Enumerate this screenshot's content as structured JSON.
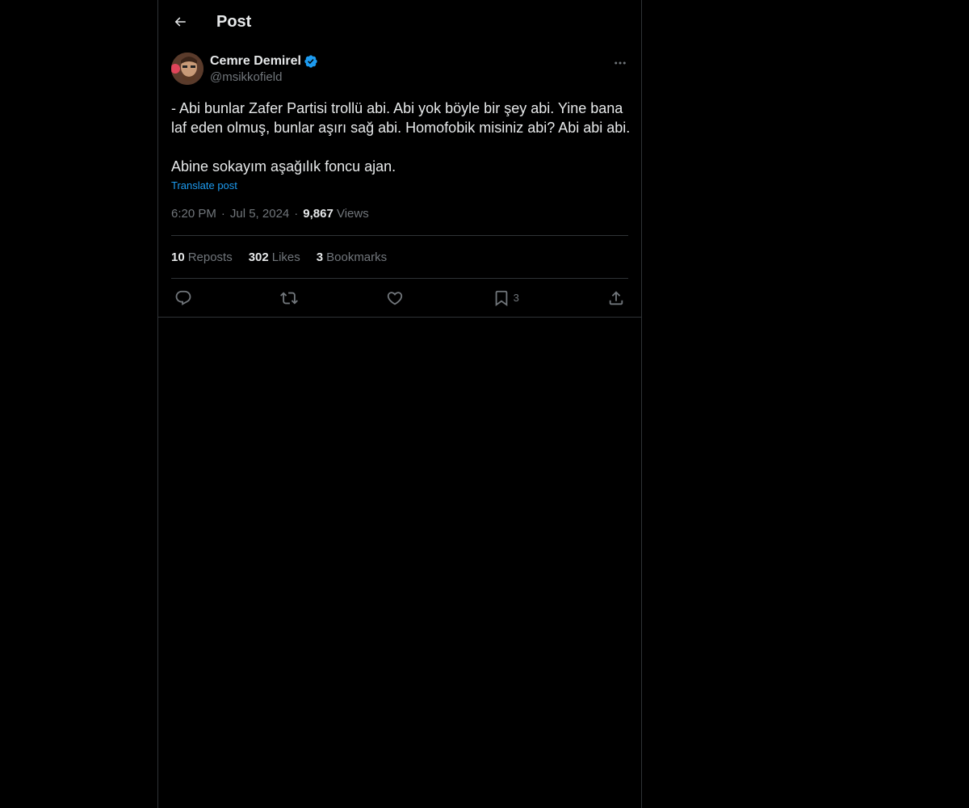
{
  "header": {
    "title": "Post",
    "back_icon": "arrow-left-icon"
  },
  "author": {
    "display_name": "Cemre Demirel",
    "handle": "@msikkofield",
    "verified": true,
    "verified_color": "#1d9bf0"
  },
  "post": {
    "text": "- Abi bunlar Zafer Partisi trollü abi. Abi yok böyle bir şey abi. Yine bana laf eden olmuş, bunlar aşırı sağ abi. Homofobik misiniz abi? Abi abi abi.\n\nAbine sokayım aşağılık foncu ajan.",
    "translate_label": "Translate post",
    "time": "6:20 PM",
    "date": "Jul 5, 2024",
    "views_count": "9,867",
    "views_label": "Views",
    "separator": "·"
  },
  "stats": {
    "reposts_count": "10",
    "reposts_label": "Reposts",
    "likes_count": "302",
    "likes_label": "Likes",
    "bookmarks_count": "3",
    "bookmarks_label": "Bookmarks"
  },
  "actions": {
    "bookmark_count": "3"
  },
  "colors": {
    "background": "#000000",
    "text": "#e7e9ea",
    "muted": "#71767b",
    "border": "#2f3336",
    "accent": "#1d9bf0"
  }
}
